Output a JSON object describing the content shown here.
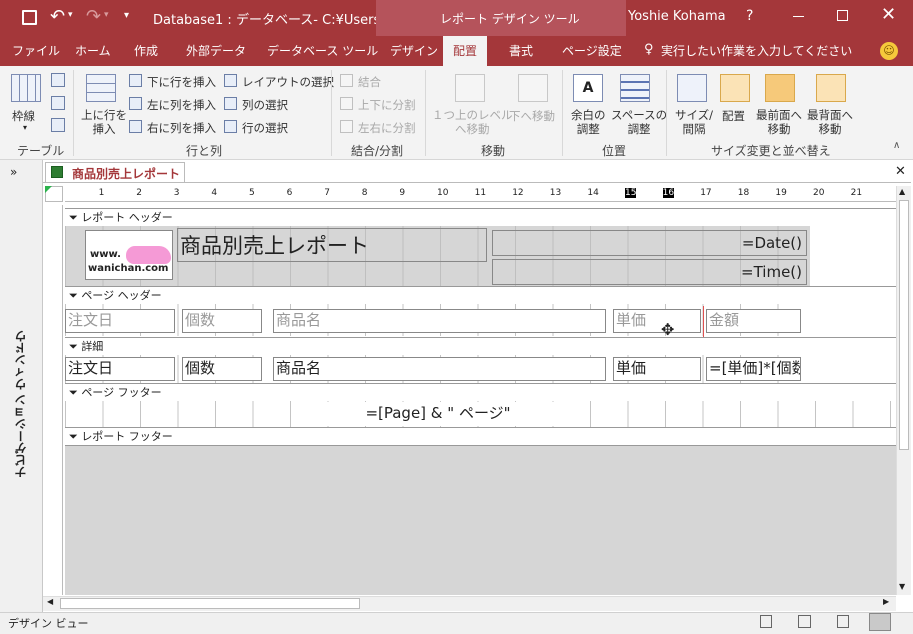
{
  "titlebar": {
    "title": "Database1 : データベース- C:¥Users…",
    "context_title": "レポート デザイン ツール",
    "user": "Yoshie Kohama",
    "help": "?"
  },
  "tabs": [
    "ファイル",
    "ホーム",
    "作成",
    "外部データ",
    "データベース ツール",
    "デザイン",
    "配置",
    "書式",
    "ページ設定"
  ],
  "active_tab": "配置",
  "tell_me": "実行したい作業を入力してください",
  "ribbon": {
    "table": {
      "label": "テーブル",
      "gridlines": "枠線"
    },
    "rows_cols": {
      "label": "行と列",
      "insert_above": "上に行を\n挿入",
      "insert_below": "下に行を挿入",
      "insert_left": "左に列を挿入",
      "insert_right": "右に列を挿入",
      "select_layout": "レイアウトの選択",
      "select_column": "列の選択",
      "select_row": "行の選択"
    },
    "merge": {
      "label": "結合/分割",
      "merge": "結合",
      "split_vertical": "上下に分割",
      "split_horizontal": "左右に分割"
    },
    "move": {
      "label": "移動",
      "move_up": "１つ上のレベル\nへ移動",
      "move_down": "下へ移動"
    },
    "position": {
      "label": "位置",
      "margins": "余白の\n調整",
      "padding": "スペースの\n調整"
    },
    "size": {
      "label": "サイズ変更と並べ替え",
      "size_spacing": "サイズ/\n間隔",
      "align": "配置",
      "bring_front": "最前面へ\n移動",
      "send_back": "最背面へ\n移動"
    }
  },
  "document": {
    "tab_title": "商品別売上レポート",
    "nav_pane": "ナビゲーション ウィンドウ",
    "ruler_numbers": [
      "1",
      "2",
      "3",
      "4",
      "5",
      "6",
      "7",
      "8",
      "9",
      "10",
      "11",
      "12",
      "13",
      "14",
      "15",
      "16",
      "17",
      "18",
      "19",
      "20",
      "21"
    ],
    "sections": {
      "report_header": "レポート ヘッダー",
      "page_header": "ページ ヘッダー",
      "detail": "詳細",
      "page_footer": "ページ フッター",
      "report_footer": "レポート フッター"
    },
    "report_title": "商品別売上レポート",
    "logo_line1": "www.",
    "logo_line2": "wanichan.com",
    "date_expr": "=Date()",
    "time_expr": "=Time()",
    "header_labels": [
      "注文日",
      "個数",
      "商品名",
      "単価",
      "金額"
    ],
    "detail_fields": [
      "注文日",
      "個数",
      "商品名",
      "単価",
      "=[単価]*[個数]"
    ],
    "page_expr": "=[Page] & \" ページ\""
  },
  "status": {
    "mode": "デザイン ビュー"
  },
  "colors": {
    "accent": "#a4373a",
    "context": "#b5535b",
    "section_bg": "#d6d6d6"
  }
}
